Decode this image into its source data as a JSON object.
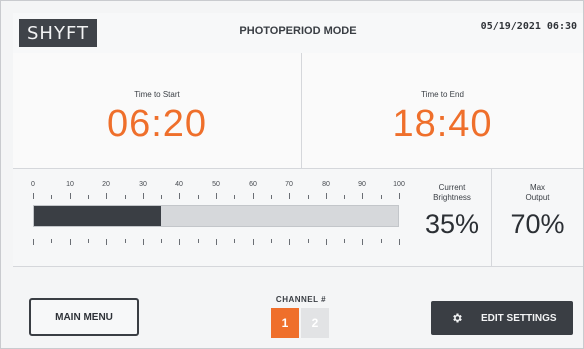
{
  "header": {
    "logo": "SHYFT",
    "mode_title": "PHOTOPERIOD MODE",
    "datetime": "05/19/2021 06:30"
  },
  "timers": {
    "start": {
      "label": "Time to Start",
      "value": "06:20"
    },
    "end": {
      "label": "Time to End",
      "value": "18:40"
    }
  },
  "brightness": {
    "scale_labels": [
      "0",
      "10",
      "20",
      "30",
      "40",
      "50",
      "60",
      "70",
      "80",
      "90",
      "100"
    ],
    "level_percent": 35,
    "current_label": "Current\nBrightness",
    "current_value": "35%",
    "max_label": "Max\nOutput",
    "max_value": "70%"
  },
  "footer": {
    "main_menu_label": "MAIN MENU",
    "channel_label": "CHANNEL #",
    "channels": [
      "1",
      "2"
    ],
    "active_channel": "1",
    "edit_settings_label": "EDIT SETTINGS"
  },
  "colors": {
    "accent": "#ef6f2b",
    "dark": "#3a3e44"
  },
  "icons": {
    "settings": "gear-icon"
  }
}
